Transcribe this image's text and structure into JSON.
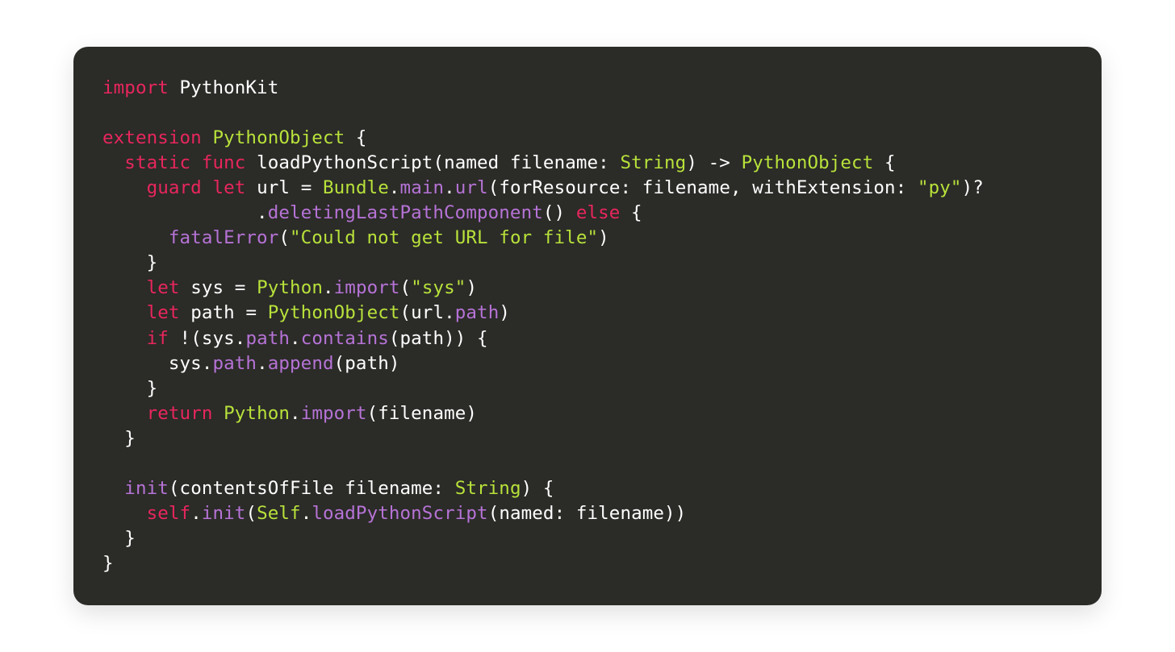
{
  "code": {
    "colors": {
      "background": "#2b2b28",
      "keyword": "#e8265c",
      "type": "#b8e23a",
      "function": "#b673d6",
      "string": "#b8e23a",
      "plain": "#ffffff"
    },
    "language": "swift",
    "tokens": {
      "l1": {
        "t1": "import",
        "t2": " PythonKit"
      },
      "l3": {
        "t1": "extension",
        "t2": " ",
        "t3": "PythonObject",
        "t4": " {"
      },
      "l4": {
        "pad": "  ",
        "t1": "static",
        "sp1": " ",
        "t2": "func",
        "sp2": " ",
        "t3": "loadPythonScript",
        "t4": "(",
        "t5": "named",
        "sp3": " ",
        "t6": "filename",
        "t7": ": ",
        "t8": "String",
        "t9": ") ",
        "t10": "->",
        "sp4": " ",
        "t11": "PythonObject",
        "t12": " {"
      },
      "l5": {
        "pad": "    ",
        "t1": "guard",
        "sp1": " ",
        "t2": "let",
        "sp2": " ",
        "t3": "url ",
        "t4": "=",
        "sp3": " ",
        "t5": "Bundle",
        "t6": ".",
        "t7": "main",
        "t8": ".",
        "t9": "url",
        "t10": "(",
        "t11": "forResource",
        "t12": ": filename, ",
        "t13": "withExtension",
        "t14": ": ",
        "t15": "\"py\"",
        "t16": ")?"
      },
      "l6": {
        "pad": "              ",
        "t1": ".",
        "t2": "deletingLastPathComponent",
        "t3": "() ",
        "t4": "else",
        "t5": " {"
      },
      "l7": {
        "pad": "      ",
        "t1": "fatalError",
        "t2": "(",
        "t3": "\"Could not get URL for file\"",
        "t4": ")"
      },
      "l8": {
        "pad": "    ",
        "t1": "}"
      },
      "l9": {
        "pad": "    ",
        "t1": "let",
        "sp1": " ",
        "t2": "sys ",
        "t3": "=",
        "sp2": " ",
        "t4": "Python",
        "t5": ".",
        "t6": "import",
        "t7": "(",
        "t8": "\"sys\"",
        "t9": ")"
      },
      "l10": {
        "pad": "    ",
        "t1": "let",
        "sp1": " ",
        "t2": "path ",
        "t3": "=",
        "sp2": " ",
        "t4": "PythonObject",
        "t5": "(url.",
        "t6": "path",
        "t7": ")"
      },
      "l11": {
        "pad": "    ",
        "t1": "if",
        "sp1": " ",
        "t2": "!(sys.",
        "t3": "path",
        "t4": ".",
        "t5": "contains",
        "t6": "(path)) {"
      },
      "l12": {
        "pad": "      ",
        "t1": "sys.",
        "t2": "path",
        "t3": ".",
        "t4": "append",
        "t5": "(path)"
      },
      "l13": {
        "pad": "    ",
        "t1": "}"
      },
      "l14": {
        "pad": "    ",
        "t1": "return",
        "sp1": " ",
        "t2": "Python",
        "t3": ".",
        "t4": "import",
        "t5": "(filename)"
      },
      "l15": {
        "pad": "  ",
        "t1": "}"
      },
      "l17": {
        "pad": "  ",
        "t1": "init",
        "t2": "(",
        "t3": "contentsOfFile",
        "sp1": " ",
        "t4": "filename",
        "t5": ": ",
        "t6": "String",
        "t7": ") {"
      },
      "l18": {
        "pad": "    ",
        "t1": "self",
        "t2": ".",
        "t3": "init",
        "t4": "(",
        "t5": "Self",
        "t6": ".",
        "t7": "loadPythonScript",
        "t8": "(",
        "t9": "named",
        "t10": ": filename))"
      },
      "l19": {
        "pad": "  ",
        "t1": "}"
      },
      "l20": {
        "t1": "}"
      }
    }
  }
}
